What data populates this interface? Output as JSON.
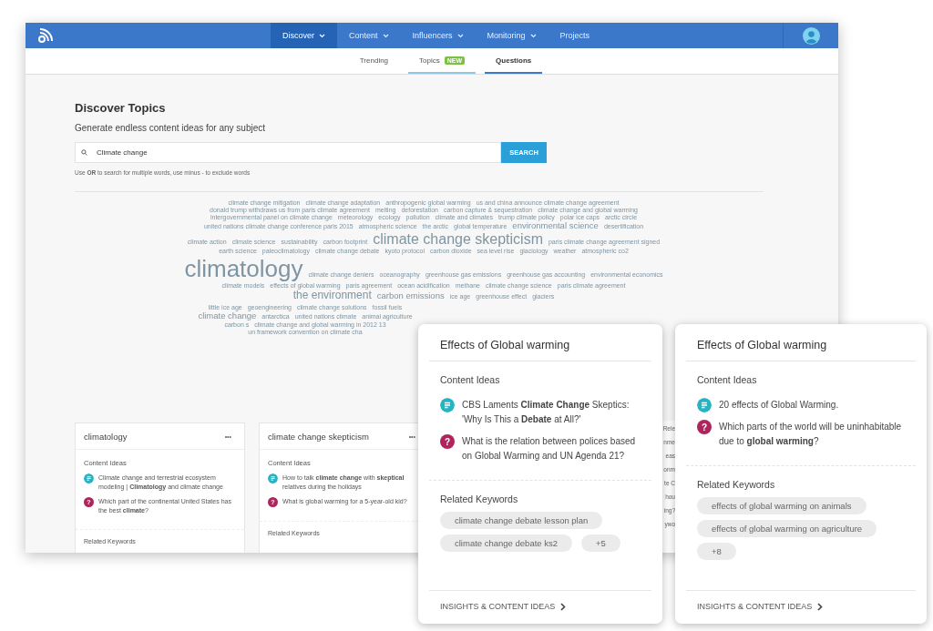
{
  "nav": {
    "items": [
      {
        "label": "Discover",
        "selected": true,
        "dropdown": true
      },
      {
        "label": "Content",
        "selected": false,
        "dropdown": true
      },
      {
        "label": "Influencers",
        "selected": false,
        "dropdown": true
      },
      {
        "label": "Monitoring",
        "selected": false,
        "dropdown": true
      },
      {
        "label": "Projects",
        "selected": false,
        "dropdown": false
      }
    ]
  },
  "subtabs": [
    {
      "label": "Trending",
      "selected": false,
      "hover": false
    },
    {
      "label": "Topics",
      "badge": "NEW",
      "selected": false,
      "hover": true
    },
    {
      "label": "Questions",
      "selected": true,
      "hover": false
    }
  ],
  "page": {
    "title": "Discover Topics",
    "subtitle": "Generate endless content ideas for any subject",
    "search": {
      "value": "Climate change",
      "button": "SEARCH"
    },
    "hint": "Use **OR** to search for multiple words, use minus - to exclude words"
  },
  "word_cloud": {
    "upper": [
      {
        "text": "climate change mitigation",
        "kind": "xs"
      },
      {
        "text": "climate change adaptation",
        "kind": "xs"
      },
      {
        "text": "anthropogenic global warming",
        "kind": "xs"
      },
      {
        "text": "us and china announce climate change agreement",
        "kind": "xs"
      },
      {
        "text": "donald trump withdraws us from paris climate agreement",
        "kind": "xs"
      },
      {
        "text": "melting",
        "kind": "xs"
      },
      {
        "text": "deforestation",
        "kind": "xs"
      },
      {
        "text": "carbon capture & sequestration",
        "kind": "xs"
      },
      {
        "text": "climate change and global warming",
        "kind": "xs"
      },
      {
        "text": "intergovernmental panel on climate change",
        "kind": "xs"
      },
      {
        "text": "meteorology",
        "kind": "xs"
      },
      {
        "text": "ecology",
        "kind": "xs"
      },
      {
        "text": "pollution",
        "kind": "xs"
      },
      {
        "text": "climate and climates",
        "kind": "xs"
      },
      {
        "text": "trump climate policy",
        "kind": "xs"
      },
      {
        "text": "polar ice caps",
        "kind": "xs"
      },
      {
        "text": "arctic circle",
        "kind": "xs"
      },
      {
        "text": "united nations climate change conference paris 2015",
        "kind": "xs"
      },
      {
        "text": "atmospheric science",
        "kind": "xs"
      },
      {
        "text": "the arctic",
        "kind": "xs"
      },
      {
        "text": "global temperature",
        "kind": "xs"
      },
      {
        "text": "environmental science",
        "kind": "sm"
      },
      {
        "text": "desertification",
        "kind": "xs"
      },
      {
        "text": "climate action",
        "kind": "xs"
      },
      {
        "text": "climate science",
        "kind": "xs"
      },
      {
        "text": "sustainability",
        "kind": "xs"
      },
      {
        "text": "carbon footprint",
        "kind": "xs"
      },
      {
        "text": "climate change skepticism",
        "kind": "lg"
      },
      {
        "text": "paris climate change agreement signed",
        "kind": "xs"
      },
      {
        "text": "earth science",
        "kind": "xs"
      },
      {
        "text": "paleoclimatology",
        "kind": "xs"
      },
      {
        "text": "climate change debate",
        "kind": "xs"
      },
      {
        "text": "kyoto protocol",
        "kind": "xs"
      },
      {
        "text": "carbon dioxide",
        "kind": "xs"
      },
      {
        "text": "sea level rise",
        "kind": "xs"
      },
      {
        "text": "glaciology",
        "kind": "xs"
      },
      {
        "text": "weather",
        "kind": "xs"
      },
      {
        "text": "atmospheric co2",
        "kind": "xs"
      },
      {
        "text": "climatology",
        "kind": "xl"
      },
      {
        "text": "climate change deniers",
        "kind": "xs"
      },
      {
        "text": "oceanography",
        "kind": "xs"
      },
      {
        "text": "greenhouse gas emissions",
        "kind": "xs"
      },
      {
        "text": "greenhouse gas accounting",
        "kind": "xs"
      },
      {
        "text": "environmental economics",
        "kind": "xs"
      },
      {
        "text": "climate models",
        "kind": "xs"
      },
      {
        "text": "effects of global warming",
        "kind": "xs"
      },
      {
        "text": "paris agreement",
        "kind": "xs"
      },
      {
        "text": "ocean acidification",
        "kind": "xs"
      },
      {
        "text": "methane",
        "kind": "xs"
      },
      {
        "text": "climate change science",
        "kind": "xs"
      },
      {
        "text": "paris climate agreement",
        "kind": "xs"
      },
      {
        "text": "the environment",
        "kind": "md"
      },
      {
        "text": "carbon emissions",
        "kind": "sm"
      },
      {
        "text": "ice age",
        "kind": "xs"
      },
      {
        "text": "greenhouse effect",
        "kind": "xs"
      },
      {
        "text": "glaciers",
        "kind": "xs"
      }
    ],
    "lower": [
      {
        "text": "little ice age",
        "kind": "xs"
      },
      {
        "text": "geoengineering",
        "kind": "xs"
      },
      {
        "text": "climate change solutions",
        "kind": "xs"
      },
      {
        "text": "fossil fuels",
        "kind": "xs"
      },
      {
        "text": "climate change",
        "kind": "sm"
      },
      {
        "text": "antarctica",
        "kind": "xs"
      },
      {
        "text": "united nations climate",
        "kind": "xs"
      },
      {
        "text": "animal agriculture",
        "kind": "xs"
      },
      {
        "text": "carbon s",
        "kind": "xs"
      },
      {
        "text": "climate change and global warming in 2012 13",
        "kind": "xs"
      },
      {
        "text": "un framework convention on climate cha",
        "kind": "xs"
      }
    ]
  },
  "topic_cards": [
    {
      "title": "climatology",
      "menu": "•••",
      "section": "Content Ideas",
      "ideas": [
        {
          "kind": "article",
          "text": "Climate change and terrestrial ecosystem modeling | **Climatology** and climate change"
        },
        {
          "kind": "question",
          "icon_text": "?",
          "text": "Which part of the continental United States has the best **climate**?"
        }
      ],
      "keywords_label": "Related Keywords"
    },
    {
      "title": "climate change skepticism",
      "menu": "•••",
      "section": "Content Ideas",
      "ideas": [
        {
          "kind": "article",
          "text": "How to talk **climate change** with **skeptical** relatives during the holidays"
        },
        {
          "kind": "question",
          "icon_text": "?",
          "text": "What is global warming for a 5-year-old kid?"
        }
      ],
      "keywords_label": "Related Keywords"
    }
  ],
  "partial_card": {
    "fragments": [
      "Rele",
      "nme",
      "eas",
      "onm",
      "te C",
      "hou",
      "ing?",
      "ywo"
    ]
  },
  "popup_cards": [
    {
      "title": "Effects of Global warming",
      "section": "Content Ideas",
      "ideas": [
        {
          "kind": "article",
          "text": "CBS Laments **Climate Change** Skeptics: 'Why Is This a **Debate** at All?'"
        },
        {
          "kind": "question",
          "icon_text": "?",
          "text": "What is the relation between polices based on Global Warming and UN Agenda 21?"
        }
      ],
      "keywords_label": "Related Keywords",
      "keywords": [
        "climate change debate lesson plan",
        "climate change debate ks2",
        "+5"
      ],
      "footer": "INSIGHTS & CONTENT IDEAS"
    },
    {
      "title": "Effects of Global warming",
      "section": "Content Ideas",
      "ideas": [
        {
          "kind": "article",
          "text": "20 effects of Global Warming."
        },
        {
          "kind": "question",
          "icon_text": "?",
          "text": "Which parts of the world will be uninhabitable due to **global warming**?"
        }
      ],
      "keywords_label": "Related Keywords",
      "keywords": [
        "effects of global warming on animals",
        "effects of global warming on agriculture",
        "+8"
      ],
      "footer": "INSIGHTS & CONTENT IDEAS"
    }
  ]
}
